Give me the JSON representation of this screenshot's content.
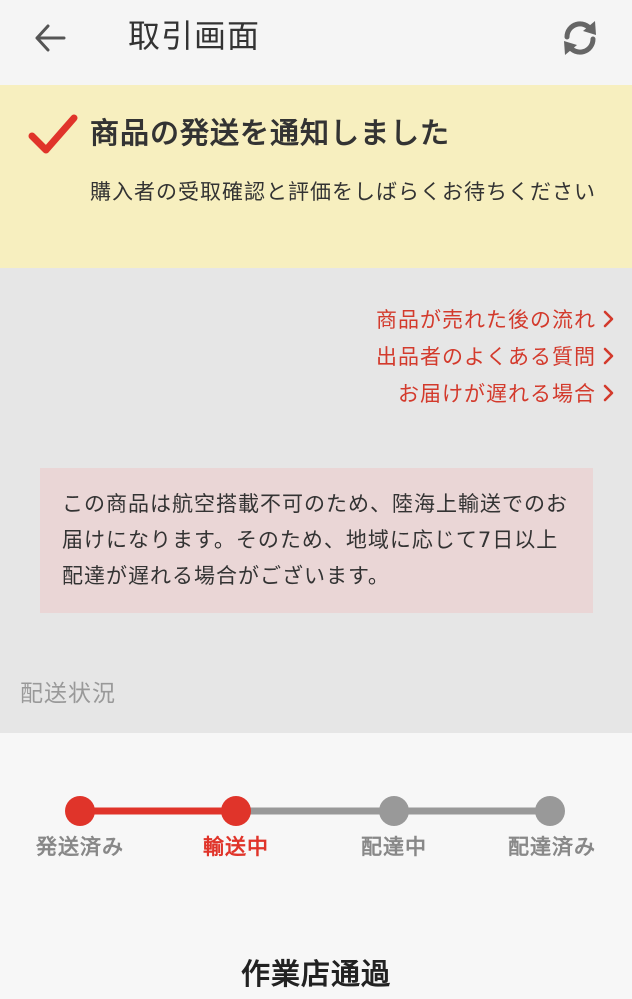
{
  "header": {
    "title": "取引画面",
    "back_icon": "arrow-left-icon",
    "refresh_icon": "refresh-icon"
  },
  "notice": {
    "icon": "checkmark-icon",
    "title": "商品の発送を通知しました",
    "body": "購入者の受取確認と評価をしばらくお待ちください",
    "background": "#f7efbf",
    "check_color": "#e0342a"
  },
  "links": [
    {
      "label": "商品が売れた後の流れ"
    },
    {
      "label": "出品者のよくある質問"
    },
    {
      "label": "お届けが遅れる場合"
    }
  ],
  "warning": {
    "text": "この商品は航空搭載不可のため、陸海上輸送でのお届けになります。そのため、地域に応じて7日以上配達が遅れる場合がございます。"
  },
  "shipping_status": {
    "section_label": "配送状況",
    "steps": [
      {
        "label": "発送済み",
        "state": "done"
      },
      {
        "label": "輸送中",
        "state": "active"
      },
      {
        "label": "配達中",
        "state": "pending"
      },
      {
        "label": "配達済み",
        "state": "pending"
      }
    ],
    "current_status": "作業店通過",
    "active_color": "#e0342a",
    "inactive_color": "#999999"
  }
}
